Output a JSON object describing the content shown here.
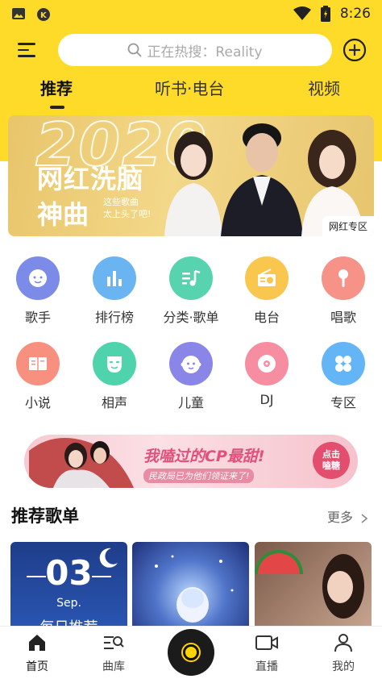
{
  "status_bar": {
    "time": "8:26"
  },
  "search": {
    "placeholder": "正在热搜：Reality"
  },
  "tabs": [
    {
      "label": "推荐",
      "active": true
    },
    {
      "label": "听书·电台",
      "active": false
    },
    {
      "label": "视频",
      "active": false
    }
  ],
  "banner": {
    "year": "2020",
    "title_line1": "网红洗脑",
    "title_line2": "神曲",
    "subtitle_line1": "这些歌曲",
    "subtitle_line2": "太上头了吧!",
    "badge": "网红专区"
  },
  "categories": [
    {
      "label": "歌手",
      "icon": "singer-icon",
      "color": "#7C8BE8"
    },
    {
      "label": "排行榜",
      "icon": "chart-icon",
      "color": "#6BB4F2"
    },
    {
      "label": "分类·歌单",
      "icon": "music-list-icon",
      "color": "#58D3B0"
    },
    {
      "label": "电台",
      "icon": "radio-icon",
      "color": "#F9C64E"
    },
    {
      "label": "唱歌",
      "icon": "microphone-icon",
      "color": "#F69288"
    },
    {
      "label": "小说",
      "icon": "book-icon",
      "color": "#F7907F"
    },
    {
      "label": "相声",
      "icon": "mask-icon",
      "color": "#4FD3AC"
    },
    {
      "label": "儿童",
      "icon": "child-icon",
      "color": "#8A86E8"
    },
    {
      "label": "DJ",
      "icon": "vinyl-icon",
      "color": "#F78DA1"
    },
    {
      "label": "专区",
      "icon": "grid-icon",
      "color": "#64B5F5"
    }
  ],
  "ad": {
    "headline": "我嗑过的CP最甜!",
    "subline": "民政局已为他们领证来了!",
    "cta_line1": "点击",
    "cta_line2": "嗑糖"
  },
  "recommended": {
    "title": "推荐歌单",
    "more": "更多",
    "daily_card": {
      "day": "03",
      "month": "Sep.",
      "label": "每日推荐"
    }
  },
  "bottom_nav": [
    {
      "label": "首页",
      "icon": "home-icon",
      "active": true
    },
    {
      "label": "曲库",
      "icon": "library-search-icon",
      "active": false
    },
    {
      "label": "直播",
      "icon": "live-camera-icon",
      "active": false
    },
    {
      "label": "我的",
      "icon": "profile-icon",
      "active": false
    }
  ],
  "colors": {
    "brand_yellow": "#FFDB29"
  }
}
